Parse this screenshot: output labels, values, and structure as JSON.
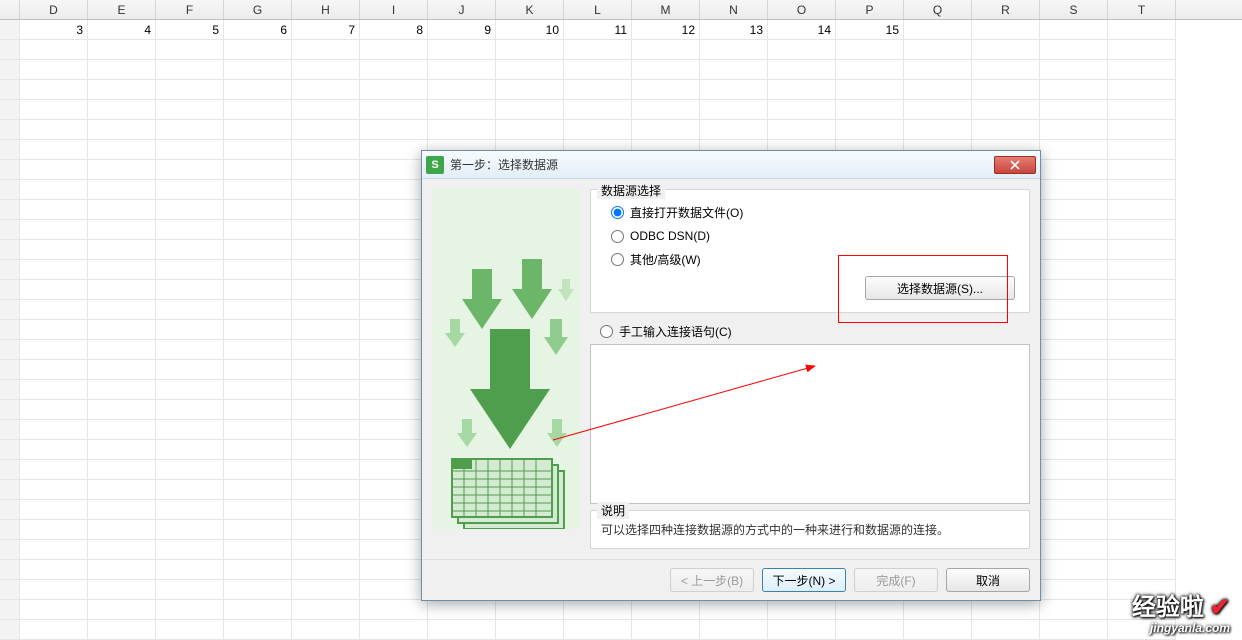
{
  "sheet": {
    "column_letters": [
      "D",
      "E",
      "F",
      "G",
      "H",
      "I",
      "J",
      "K",
      "L",
      "M",
      "N",
      "O",
      "P",
      "Q",
      "R",
      "S",
      "T"
    ],
    "row1_values": [
      "3",
      "4",
      "5",
      "6",
      "7",
      "8",
      "9",
      "10",
      "11",
      "12",
      "13",
      "14",
      "15",
      "",
      "",
      "",
      ""
    ]
  },
  "dialog": {
    "title": "第一步：选择数据源",
    "group_datasource_label": "数据源选择",
    "radio_open_file": "直接打开数据文件(O)",
    "radio_odbc": "ODBC DSN(D)",
    "radio_other": "其他/高级(W)",
    "select_source_button": "选择数据源(S)...",
    "radio_manual_conn": "手工输入连接语句(C)",
    "desc_label": "说明",
    "desc_text": "可以选择四种连接数据源的方式中的一种来进行和数据源的连接。",
    "footer": {
      "back": "< 上一步(B)",
      "next": "下一步(N) >",
      "finish": "完成(F)",
      "cancel": "取消"
    }
  },
  "watermark": {
    "top": "经验啦",
    "check": "✔",
    "bottom": "jingyanla.com"
  }
}
